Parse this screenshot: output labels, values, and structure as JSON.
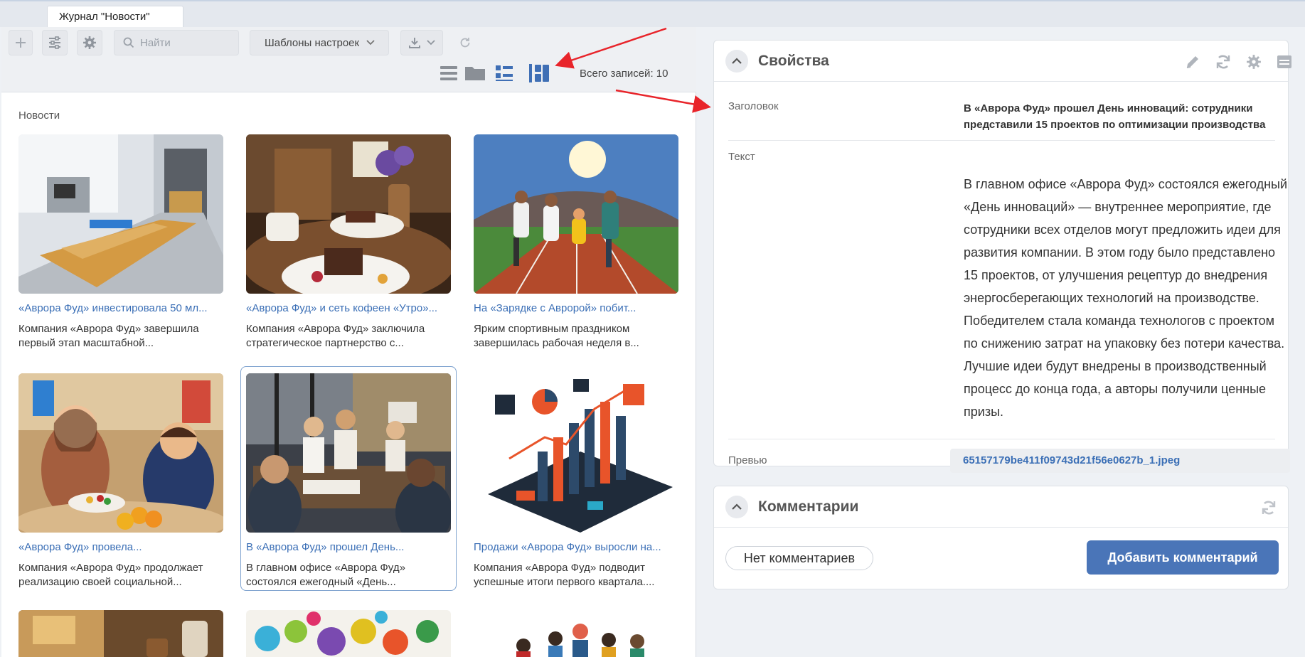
{
  "tab": {
    "title": "Журнал \"Новости\""
  },
  "toolbar": {
    "search_placeholder": "Найти",
    "templates_label": "Шаблоны настроек",
    "total_label": "Всего записей: 10",
    "icons": [
      "plus-icon",
      "filter-sliders-icon",
      "gear-icon",
      "search-icon",
      "chevron-down-icon",
      "download-icon",
      "refresh-icon"
    ],
    "view_icons": [
      "list-view-icon",
      "folder-view-icon",
      "tile-list-view-icon",
      "card-view-icon"
    ]
  },
  "section": {
    "label": "Новости"
  },
  "cards": [
    {
      "title": "«Аврора Фуд» инвестировала 50 мл...",
      "desc": "Компания «Аврора Фуд» завершила первый этап масштабной..."
    },
    {
      "title": "«Аврора Фуд» и сеть кофеен «Утро»...",
      "desc": "Компания «Аврора Фуд» заключила стратегическое партнерство с..."
    },
    {
      "title": "На «Зарядке с Авророй» побит...",
      "desc": "Ярким спортивным праздником завершилась рабочая неделя в..."
    },
    {
      "title": "«Аврора Фуд» провела...",
      "desc": "Компания «Аврора Фуд» продолжает реализацию своей социальной..."
    },
    {
      "title": "В «Аврора Фуд» прошел День...",
      "desc": "В главном офисе «Аврора Фуд» состоялся ежегодный «День..."
    },
    {
      "title": "Продажи «Аврора Фуд» выросли на...",
      "desc": "Компания «Аврора Фуд» подводит успешные итоги первого квартала...."
    }
  ],
  "properties": {
    "panel_title": "Свойства",
    "heading_label": "Заголовок",
    "heading_value": "В «Аврора Фуд» прошел День инноваций: сотрудники представили 15 проектов по оптимизации производства",
    "text_label": "Текст",
    "text_value": "В главном офисе «Аврора Фуд» состоялся ежегодный «День инноваций» — внутреннее мероприятие, где сотрудники всех отделов могут предложить идеи для развития компании. В этом году было представлено 15 проектов, от улучшения рецептур до внедрения энергосберегающих технологий на производстве. Победителем стала команда технологов с проектом по снижению затрат на упаковку без потери качества. Лучшие идеи будут внедрены в производственный процесс до конца года, а авторы получили ценные призы.",
    "preview_label": "Превью",
    "preview_value": "65157179be411f09743d21f56e0627b_1.jpeg",
    "icons": [
      "edit-pencil-icon",
      "refresh-icon",
      "gear-icon",
      "panel-layout-icon"
    ]
  },
  "comments": {
    "panel_title": "Комментарии",
    "no_comments": "Нет комментариев",
    "add_button": "Добавить комментарий"
  },
  "colors": {
    "accent": "#4a75b8",
    "link": "#3b6fb6",
    "annotation_arrow": "#e8242a"
  }
}
